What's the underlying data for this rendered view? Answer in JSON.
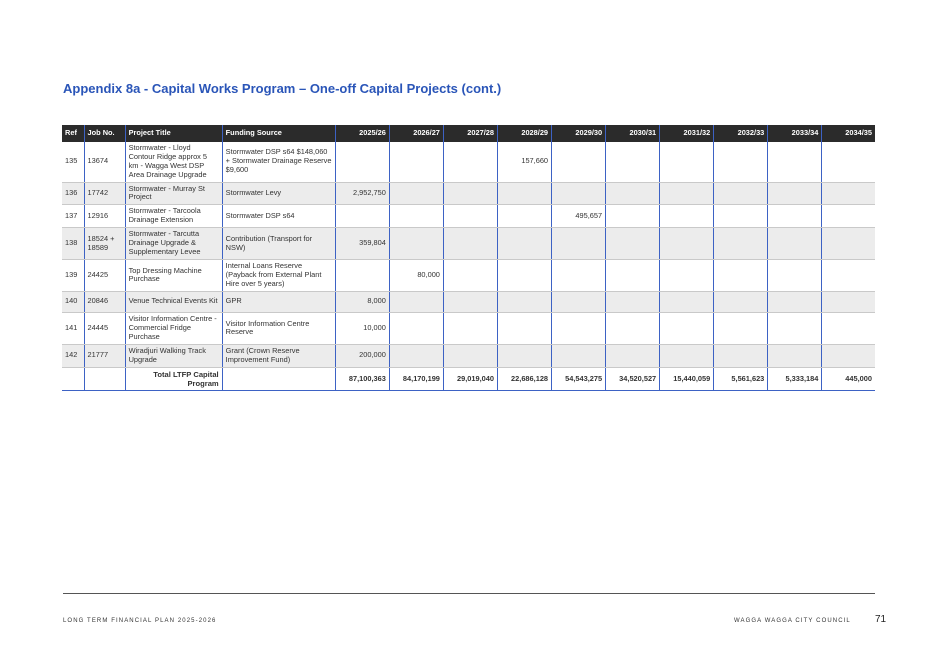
{
  "title": "Appendix 8a - Capital Works Program – One-off Capital Projects (cont.)",
  "table": {
    "headers": [
      "Ref",
      "Job No.",
      "Project Title",
      "Funding Source",
      "2025/26",
      "2026/27",
      "2027/28",
      "2028/29",
      "2029/30",
      "2030/31",
      "2031/32",
      "2032/33",
      "2033/34",
      "2034/35"
    ],
    "rows": [
      {
        "ref": "135",
        "job": "13674",
        "title": "Stormwater - Lloyd Contour Ridge approx 5 km - Wagga West DSP Area Drainage Upgrade",
        "funding": "Stormwater DSP s64 $148,060 + Stormwater Drainage Reserve $9,600",
        "values": [
          "",
          "",
          "",
          "157,660",
          "",
          "",
          "",
          "",
          "",
          ""
        ]
      },
      {
        "ref": "136",
        "job": "17742",
        "title": "Stormwater - Murray St Project",
        "funding": "Stormwater Levy",
        "values": [
          "2,952,750",
          "",
          "",
          "",
          "",
          "",
          "",
          "",
          "",
          ""
        ]
      },
      {
        "ref": "137",
        "job": "12916",
        "title": "Stormwater - Tarcoola Drainage Extension",
        "funding": "Stormwater DSP s64",
        "values": [
          "",
          "",
          "",
          "",
          "495,657",
          "",
          "",
          "",
          "",
          ""
        ]
      },
      {
        "ref": "138",
        "job": "18524 + 18589",
        "title": "Stormwater - Tarcutta Drainage Upgrade & Supplementary Levee",
        "funding": "Contribution (Transport for NSW)",
        "values": [
          "359,804",
          "",
          "",
          "",
          "",
          "",
          "",
          "",
          "",
          ""
        ]
      },
      {
        "ref": "139",
        "job": "24425",
        "title": "Top Dressing Machine Purchase",
        "funding": "Internal Loans Reserve (Payback from External Plant Hire over 5 years)",
        "values": [
          "",
          "80,000",
          "",
          "",
          "",
          "",
          "",
          "",
          "",
          ""
        ]
      },
      {
        "ref": "140",
        "job": "20846",
        "title": "Venue Technical Events Kit",
        "funding": "GPR",
        "values": [
          "8,000",
          "",
          "",
          "",
          "",
          "",
          "",
          "",
          "",
          ""
        ]
      },
      {
        "ref": "141",
        "job": "24445",
        "title": "Visitor Information Centre - Commercial Fridge Purchase",
        "funding": "Visitor Information Centre Reserve",
        "values": [
          "10,000",
          "",
          "",
          "",
          "",
          "",
          "",
          "",
          "",
          ""
        ]
      },
      {
        "ref": "142",
        "job": "21777",
        "title": "Wiradjuri Walking Track Upgrade",
        "funding": "Grant (Crown Reserve Improvement Fund)",
        "values": [
          "200,000",
          "",
          "",
          "",
          "",
          "",
          "",
          "",
          "",
          ""
        ]
      }
    ],
    "total": {
      "label": "Total LTFP Capital Program",
      "values": [
        "87,100,363",
        "84,170,199",
        "29,019,040",
        "22,686,128",
        "54,543,275",
        "34,520,527",
        "15,440,059",
        "5,561,623",
        "5,333,184",
        "445,000"
      ]
    }
  },
  "footer": {
    "left": "LONG TERM FINANCIAL PLAN 2025-2026",
    "right": "WAGGA WAGGA CITY COUNCIL",
    "page_number": "71"
  }
}
